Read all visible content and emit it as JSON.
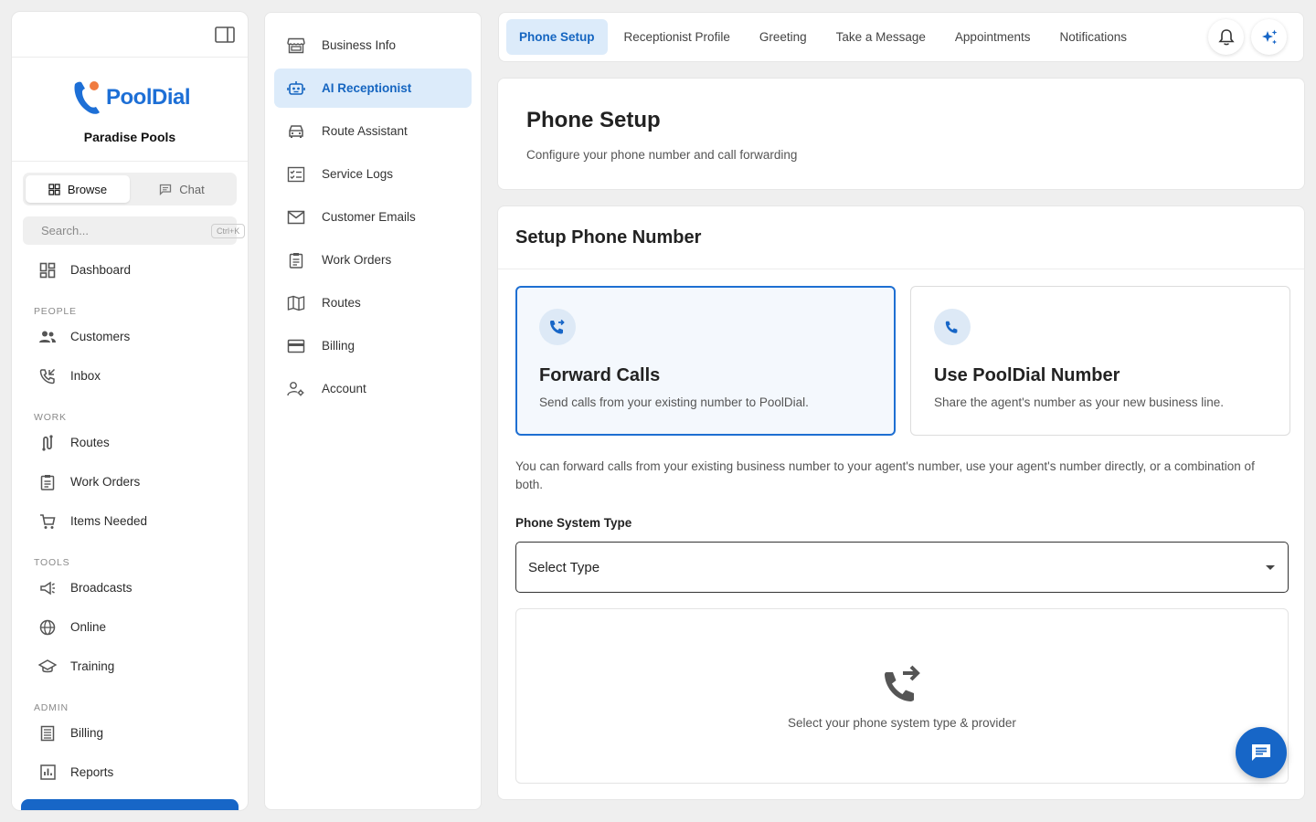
{
  "brand": {
    "logo_text": "PoolDial",
    "company": "Paradise Pools"
  },
  "sidebar": {
    "seg": {
      "browse": "Browse",
      "chat": "Chat"
    },
    "search": {
      "placeholder": "Search...",
      "shortcut": "Ctrl+K"
    },
    "dashboard": "Dashboard",
    "sections": {
      "people": "PEOPLE",
      "work": "WORK",
      "tools": "TOOLS",
      "admin": "ADMIN"
    },
    "people_items": [
      {
        "label": "Customers",
        "icon": "people-icon"
      },
      {
        "label": "Inbox",
        "icon": "phone-inbox-icon"
      }
    ],
    "work_items": [
      {
        "label": "Routes",
        "icon": "route-icon"
      },
      {
        "label": "Work Orders",
        "icon": "clipboard-icon"
      },
      {
        "label": "Items Needed",
        "icon": "cart-icon"
      }
    ],
    "tools_items": [
      {
        "label": "Broadcasts",
        "icon": "megaphone-icon"
      },
      {
        "label": "Online",
        "icon": "globe-icon"
      },
      {
        "label": "Training",
        "icon": "school-icon"
      }
    ],
    "admin_items": [
      {
        "label": "Billing",
        "icon": "receipt-icon"
      },
      {
        "label": "Reports",
        "icon": "bar-chart-icon"
      }
    ]
  },
  "subnav": {
    "items": [
      {
        "label": "Business Info",
        "icon": "store-icon"
      },
      {
        "label": "AI Receptionist",
        "icon": "robot-icon",
        "active": true
      },
      {
        "label": "Route Assistant",
        "icon": "car-icon"
      },
      {
        "label": "Service Logs",
        "icon": "checklist-icon"
      },
      {
        "label": "Customer Emails",
        "icon": "mail-icon"
      },
      {
        "label": "Work Orders",
        "icon": "clipboard-icon"
      },
      {
        "label": "Routes",
        "icon": "map-icon"
      },
      {
        "label": "Billing",
        "icon": "credit-card-icon"
      },
      {
        "label": "Account",
        "icon": "account-gear-icon"
      }
    ]
  },
  "tabs": [
    "Phone Setup",
    "Receptionist Profile",
    "Greeting",
    "Take a Message",
    "Appointments",
    "Notifications"
  ],
  "header": {
    "title": "Phone Setup",
    "subtitle": "Configure your phone number and call forwarding"
  },
  "setup": {
    "title": "Setup Phone Number",
    "options": [
      {
        "title": "Forward Calls",
        "desc": "Send calls from your existing number to PoolDial.",
        "selected": true
      },
      {
        "title": "Use PoolDial Number",
        "desc": "Share the agent's number as your new business line."
      }
    ],
    "description": "You can forward calls from your existing business number to your agent's number, use your agent's number directly, or a combination of both.",
    "field_label": "Phone System Type",
    "select_value": "Select Type",
    "empty_text": "Select your phone system type & provider"
  },
  "colors": {
    "accent": "#1766c7",
    "active_bg": "#dcebfa"
  }
}
